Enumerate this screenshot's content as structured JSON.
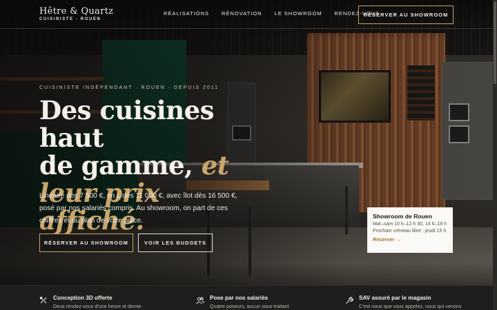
{
  "brand": {
    "name": "Hêtre & Quartz",
    "subtitle": "CUISINISTE · ROUEN"
  },
  "nav": {
    "items": [
      "RÉALISATIONS",
      "RÉNOVATION",
      "LE SHOWROOM",
      "RENDEZ-VOUS"
    ],
    "cta": "RÉSERVER AU SHOWROOM"
  },
  "hero": {
    "eyebrow": "CUISINISTE INDÉPENDANT · ROUEN · DEPUIS 2011",
    "headline_line1": "Des cuisines haut",
    "headline_line2": "de gamme,",
    "headline_accent1": "et",
    "headline_accent2": "leur prix affiché.",
    "lead": "Linéaire dès 7 500 €, en L dès 11 000 €, avec îlot dès 16 500 €, posé par nos salariés compris. Au showroom, on part de ces chiffres et du plan de votre pièce.",
    "primary_button": "RÉSERVER AU SHOWROOM",
    "secondary_button": "VOIR LES BUDGETS"
  },
  "showroom_card": {
    "title": "Showroom de Rouen",
    "hours": "Mar–sam 10 h–12 h 30, 14 h–19 h",
    "next_slot": "Prochain créneau libre : jeudi 15 h",
    "link": "Réserver →"
  },
  "features": [
    {
      "icon": "tools-icon",
      "title": "Conception 3D offerte",
      "text": "Deux rendez-vous d'une heure et demie"
    },
    {
      "icon": "users-icon",
      "title": "Pose par nos salariés",
      "text": "Quatre poseurs, aucun sous-traitant"
    },
    {
      "icon": "wrench-icon",
      "title": "SAV assuré par le magasin",
      "text": "C'est nous que vous appelez, nous qui venons"
    }
  ],
  "colors": {
    "accent": "#c9a66b",
    "dark": "#201e1c",
    "card": "#fbf9f5"
  }
}
